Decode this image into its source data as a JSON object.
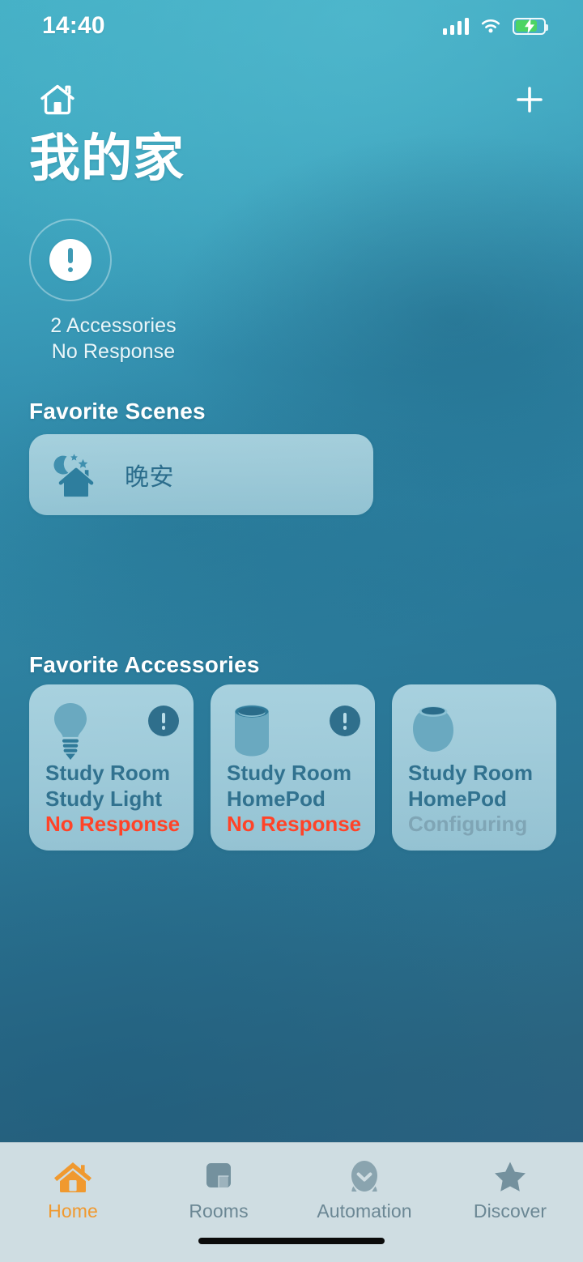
{
  "status_bar": {
    "time": "14:40",
    "cellular_icon": "signal-bars-icon",
    "wifi_icon": "wifi-icon",
    "battery_icon": "battery-charging-icon"
  },
  "nav": {
    "home_icon": "house-outline-icon",
    "add_icon": "plus-icon"
  },
  "header": {
    "title": "我的家"
  },
  "status_summary": {
    "icon": "exclamation-circle-icon",
    "line1": "2 Accessories",
    "line2": "No Response"
  },
  "scenes": {
    "heading": "Favorite Scenes",
    "items": [
      {
        "label": "晚安",
        "icon": "moon-stars-house-icon"
      }
    ]
  },
  "accessories": {
    "heading": "Favorite Accessories",
    "items": [
      {
        "room": "Study Room",
        "name": "Study Light",
        "state": "No Response",
        "state_kind": "error",
        "icon": "lightbulb-icon",
        "badge": "exclamation-badge-icon",
        "has_badge": true
      },
      {
        "room": "Study Room",
        "name": "HomePod",
        "state": "No Response",
        "state_kind": "error",
        "icon": "homepod-icon",
        "badge": "exclamation-badge-icon",
        "has_badge": true
      },
      {
        "room": "Study Room",
        "name": "HomePod",
        "state": "Configuring",
        "state_kind": "configuring",
        "icon": "homepod-mini-icon",
        "badge": "",
        "has_badge": false
      }
    ]
  },
  "tab_bar": {
    "tabs": [
      {
        "label": "Home",
        "icon": "house-filled-icon",
        "active": true
      },
      {
        "label": "Rooms",
        "icon": "rooms-icon",
        "active": false
      },
      {
        "label": "Automation",
        "icon": "automation-check-icon",
        "active": false
      },
      {
        "label": "Discover",
        "icon": "star-icon",
        "active": false
      }
    ]
  },
  "colors": {
    "accent_orange": "#f0992f",
    "error_red": "#ff4328",
    "configuring_gray": "#7fa5b5",
    "card_blue": "#b9dde8",
    "card_text": "#31728f",
    "tabbar_bg": "#cfdde2",
    "battery_green": "#4cd464"
  }
}
